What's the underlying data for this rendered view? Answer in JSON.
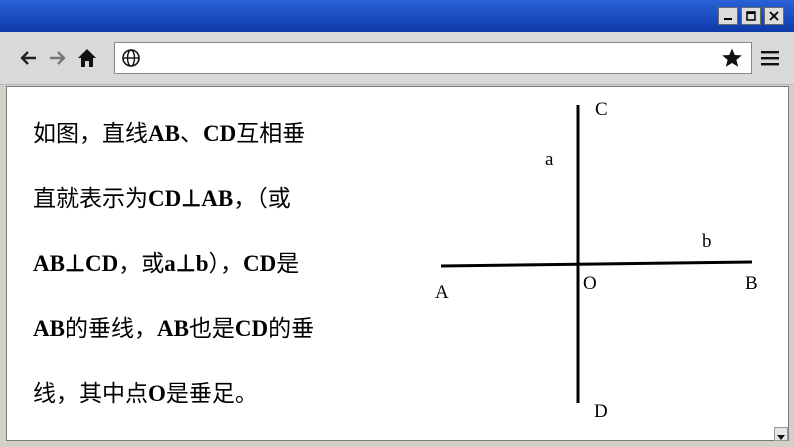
{
  "window": {
    "controls": {
      "minimize": "minimize",
      "maximize": "maximize",
      "close": "close"
    }
  },
  "toolbar": {
    "address_value": ""
  },
  "content": {
    "lines": [
      [
        "如图，直线",
        "AB",
        "、",
        "CD",
        "互相垂"
      ],
      [
        "直就表示为",
        "CD⊥AB",
        "，（或"
      ],
      [
        "AB⊥CD",
        "，或",
        "a⊥b",
        "），",
        "CD",
        "是"
      ],
      [
        "AB",
        "的垂线，",
        "AB",
        "也是",
        "CD",
        "的垂"
      ],
      [
        "线，其中点",
        "O",
        "是垂足。"
      ]
    ]
  },
  "diagram": {
    "labels": {
      "C": "C",
      "D": "D",
      "A": "A",
      "B": "B",
      "O": "O",
      "a": "a",
      "b": "b"
    }
  }
}
